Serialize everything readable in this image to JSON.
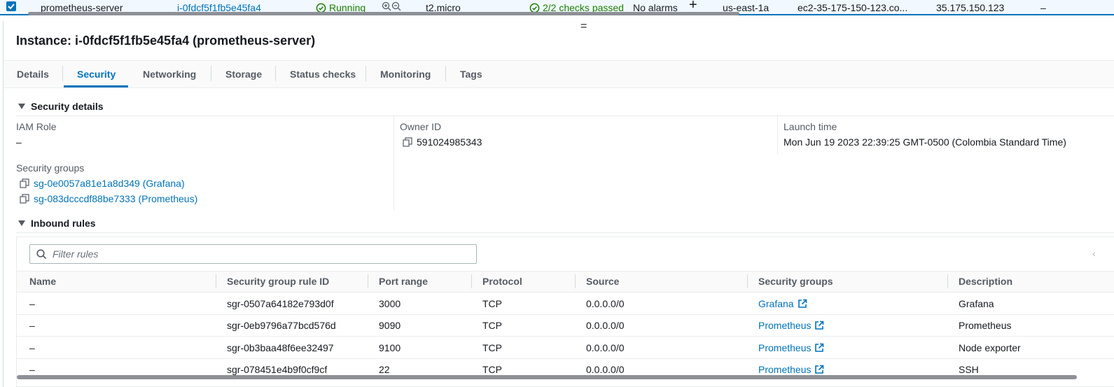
{
  "top_row": {
    "name": "prometheus-server",
    "instance_id": "i-0fdcf5f1fb5e45fa4",
    "state": "Running",
    "type": "t2.micro",
    "checks": "2/2 checks passed",
    "alarms": "No alarms",
    "plus": "+",
    "az": "us-east-1a",
    "dns": "ec2-35-175-150-123.co...",
    "ip": "35.175.150.123",
    "dash": "–"
  },
  "drag_handle": "=",
  "title": "Instance: i-0fdcf5f1fb5e45fa4 (prometheus-server)",
  "tabs": [
    {
      "label": "Details"
    },
    {
      "label": "Security"
    },
    {
      "label": "Networking"
    },
    {
      "label": "Storage"
    },
    {
      "label": "Status checks"
    },
    {
      "label": "Monitoring"
    },
    {
      "label": "Tags"
    }
  ],
  "security_details": {
    "header": "Security details",
    "iam_role_label": "IAM Role",
    "iam_role_value": "–",
    "owner_label": "Owner ID",
    "owner_value": "591024985343",
    "launch_label": "Launch time",
    "launch_value": "Mon Jun 19 2023 22:39:25 GMT-0500 (Colombia Standard Time)",
    "sg_label": "Security groups",
    "groups": [
      "sg-0e0057a81e1a8d349 (Grafana)",
      "sg-083dcccdf88be7333 (Prometheus)"
    ]
  },
  "inbound": {
    "header": "Inbound rules",
    "filter_placeholder": "Filter rules",
    "collapse": "‹",
    "columns": [
      "Name",
      "Security group rule ID",
      "Port range",
      "Protocol",
      "Source",
      "Security groups",
      "Description"
    ],
    "rows": [
      {
        "name": "–",
        "rule_id": "sgr-0507a64182e793d0f",
        "port": "3000",
        "protocol": "TCP",
        "source": "0.0.0.0/0",
        "group": "Grafana",
        "description": "Grafana"
      },
      {
        "name": "–",
        "rule_id": "sgr-0eb9796a77bcd576d",
        "port": "9090",
        "protocol": "TCP",
        "source": "0.0.0.0/0",
        "group": "Prometheus",
        "description": "Prometheus"
      },
      {
        "name": "–",
        "rule_id": "sgr-0b3baa48f6ee32497",
        "port": "9100",
        "protocol": "TCP",
        "source": "0.0.0.0/0",
        "group": "Prometheus",
        "description": "Node exporter"
      },
      {
        "name": "–",
        "rule_id": "sgr-078451e4b9f0cf9cf",
        "port": "22",
        "protocol": "TCP",
        "source": "0.0.0.0/0",
        "group": "Prometheus",
        "description": "SSH"
      }
    ]
  },
  "colors": {
    "link": "#0073bb",
    "ok": "#1d8102",
    "selected_row": "#f1f8ff"
  }
}
